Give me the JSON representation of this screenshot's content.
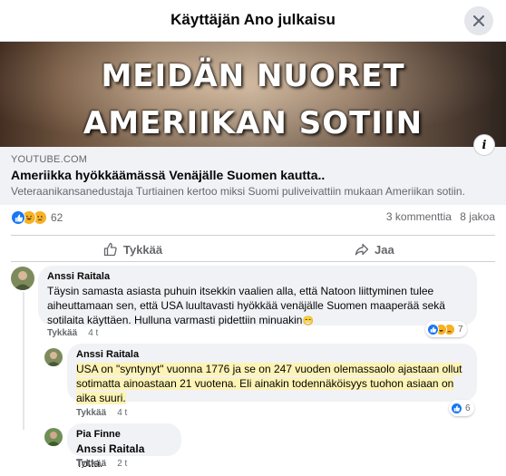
{
  "header": {
    "title": "Käyttäjän Ano julkaisu",
    "close_icon": "close-icon"
  },
  "thumbnail": {
    "line1": "MEIDÄN NUORET",
    "line2": "AMERIIKAN SOTIIN",
    "info_label": "i"
  },
  "link": {
    "domain": "YOUTUBE.COM",
    "title": "Ameriikka hyökkäämässä Venäjälle Suomen kautta..",
    "description": "Veteraanikansanedustaja Turtiainen kertoo miksi Suomi puliveivattiin mukaan Ameriikan sotiin."
  },
  "stats": {
    "reaction_count": "62",
    "comments": "3 kommenttia",
    "shares": "8 jakoa"
  },
  "actions": {
    "like": "Tykkää",
    "share": "Jaa"
  },
  "comments": [
    {
      "author": "Anssi Raitala",
      "text": "Täysin samasta asiasta puhuin itsekkin vaalien alla, että Natoon liittyminen tulee aiheuttamaan sen, että USA luultavasti hyökkää venäjälle Suomen maaperää sekä sotilaita käyttäen. Hulluna varmasti pidettiin minuakin",
      "emoji": "😁",
      "like_label": "Tykkää",
      "time": "4 t",
      "reaction_count": "7"
    },
    {
      "author": "Anssi Raitala",
      "text": "USA on \"syntynyt\" vuonna 1776 ja se on 247 vuoden olemassaolo ajastaan ollut sotimatta ainoastaan 21 vuotena. Eli ainakin todennäköisyys tuohon asiaan on aika suuri.",
      "like_label": "Tykkää",
      "time": "4 t",
      "reaction_count": "6"
    },
    {
      "author": "Pia Finne",
      "mention": "Anssi Raitala",
      "text": " Totta.",
      "like_label": "Tykkää",
      "time": "2 t"
    }
  ],
  "colors": {
    "accent": "#1877f2",
    "bubble": "#f0f2f5",
    "highlight": "#fdf3b4",
    "secondary_text": "#65676b"
  }
}
